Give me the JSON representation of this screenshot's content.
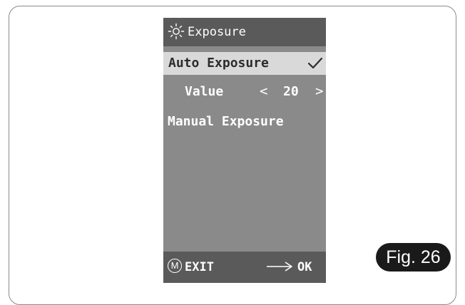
{
  "menu": {
    "title": "Exposure",
    "title_icon": "sun-icon",
    "items": {
      "auto_exposure": {
        "label": "Auto Exposure",
        "selected": true,
        "icon": "check-icon"
      },
      "value": {
        "label": "Value",
        "prev_symbol": "<",
        "value": "20",
        "next_symbol": ">"
      },
      "manual_exposure": {
        "label": "Manual Exposure"
      }
    },
    "footer": {
      "exit_key": "M",
      "exit_label": "EXIT",
      "ok_icon": "arrow-right-icon",
      "ok_label": "OK"
    }
  },
  "figure_label": "Fig. 26",
  "colors": {
    "screen_bg": "#8a8a8a",
    "bar_bg": "#5a5a5a",
    "highlight_bg": "#d9d9d9",
    "badge_bg": "#1a1a1a"
  }
}
